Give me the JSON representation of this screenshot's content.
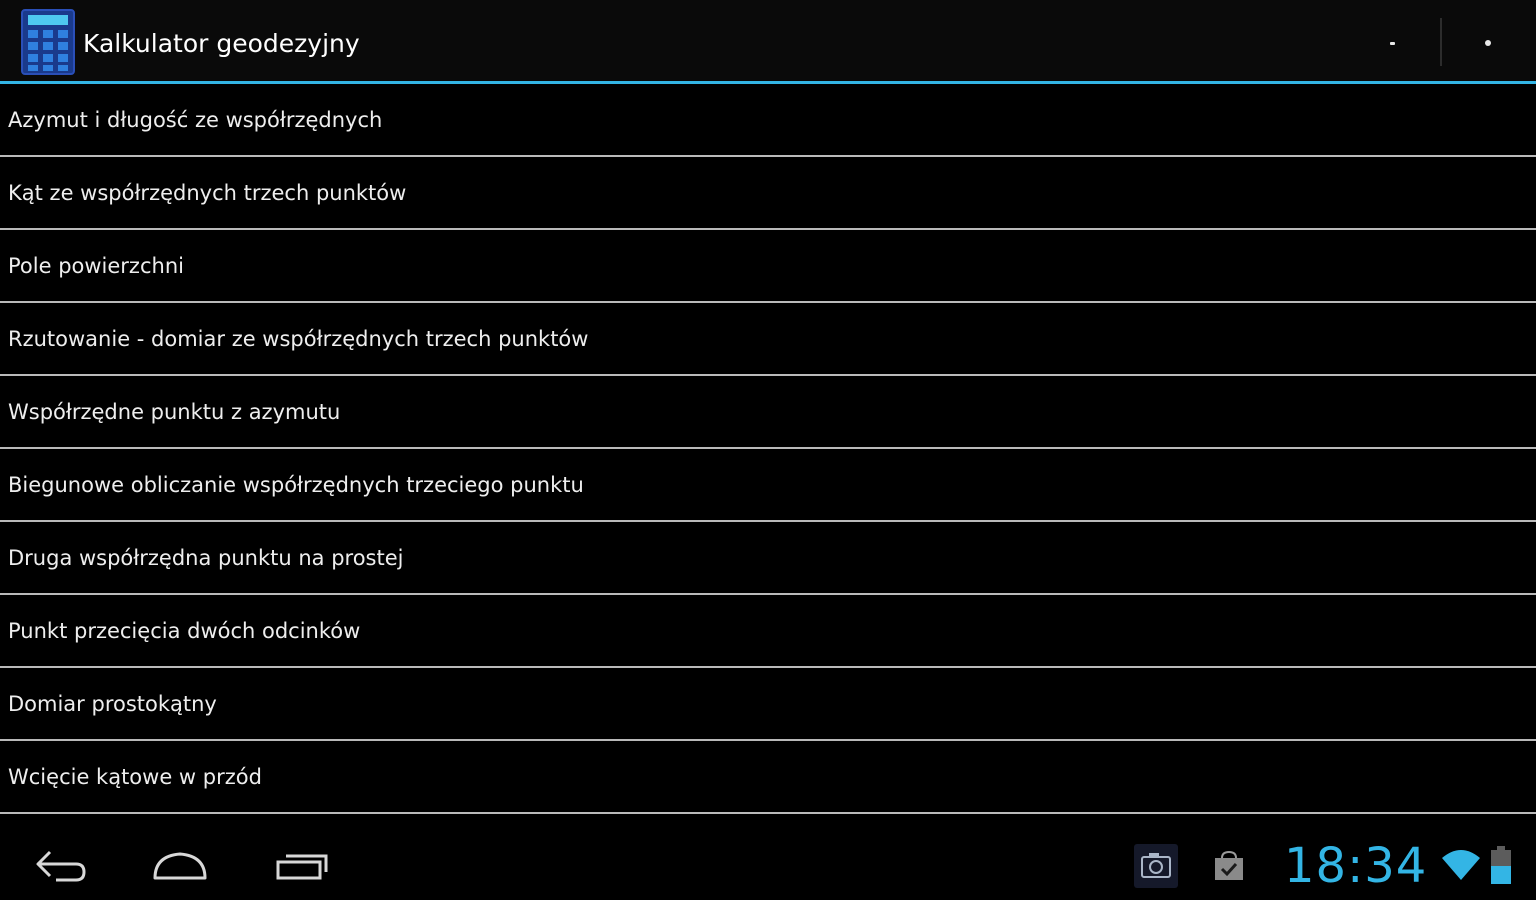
{
  "action_bar": {
    "title": "Kalkulator geodezyjny",
    "icon": "calculator-icon",
    "actions": [
      "overflow-left-icon",
      "overflow-right-icon"
    ],
    "accent_color": "#33b5e5"
  },
  "menu": {
    "items": [
      {
        "label": "Azymut i długość ze współrzędnych"
      },
      {
        "label": "Kąt ze współrzędnych trzech punktów"
      },
      {
        "label": "Pole powierzchni"
      },
      {
        "label": "Rzutowanie - domiar ze współrzędnych trzech punktów"
      },
      {
        "label": "Współrzędne punktu z azymutu"
      },
      {
        "label": "Biegunowe obliczanie współrzędnych trzeciego punktu"
      },
      {
        "label": "Druga współrzędna punktu na prostej"
      },
      {
        "label": "Punkt przecięcia dwóch odcinków"
      },
      {
        "label": "Domiar prostokątny"
      },
      {
        "label": "Wcięcie kątowe w przód"
      }
    ]
  },
  "system_bar": {
    "nav": [
      "back-icon",
      "home-icon",
      "recent-apps-icon"
    ],
    "notifications": [
      "screenshot-icon",
      "play-store-icon"
    ],
    "clock": "18:34",
    "status_icons": [
      "wifi-icon",
      "battery-icon"
    ],
    "clock_color": "#33b5e5"
  }
}
